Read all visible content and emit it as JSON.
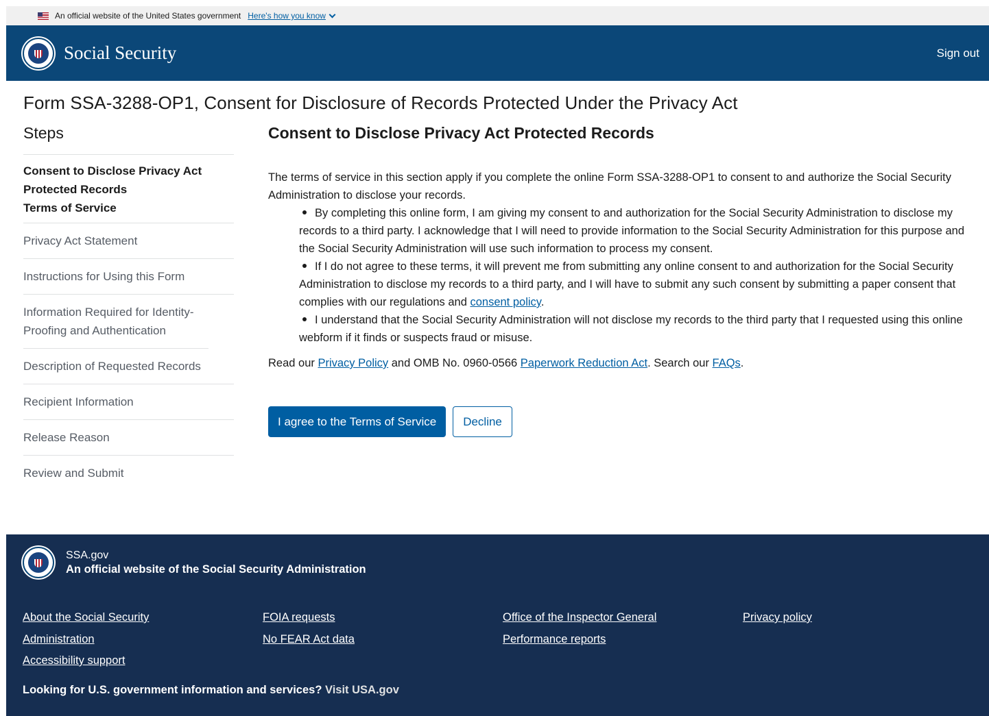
{
  "banner": {
    "official_text": "An official website of the United States government",
    "how_link": "Here's how you know"
  },
  "header": {
    "brand": "Social Security",
    "signout": "Sign out"
  },
  "form_title": "Form SSA-3288-OP1, Consent for Disclosure of Records Protected Under the Privacy Act",
  "steps": {
    "title": "Steps",
    "current_line1": "Consent to Disclose Privacy Act Protected Records",
    "current_line2": "Terms of Service",
    "items": [
      "Privacy Act Statement",
      "Instructions for Using this Form",
      "Information Required for Identity-Proofing and Authentication",
      "Description of Requested Records",
      "Recipient Information",
      "Release Reason",
      "Review and Submit"
    ]
  },
  "main": {
    "heading": "Consent to Disclose Privacy Act Protected Records",
    "intro": "The terms of service in this section apply if you complete the online Form SSA-3288-OP1 to consent to and authorize the Social Security Administration to disclose your records.",
    "bullet1": "By completing this online form, I am giving my consent to and authorization for the Social Security Administration to disclose my records to a third party.  I acknowledge that I will need to provide information to the Social Security Administration for this purpose and the Social Security Administration will use such information to process my consent.",
    "bullet2_pre": "If I do not agree to these terms, it will prevent me from submitting any online consent to and authorization for the Social Security Administration to disclose my records to a third party, and I will have to submit any such consent by submitting a paper consent that complies with our regulations and ",
    "bullet2_link": "consent policy",
    "bullet2_post": ".",
    "bullet3": "I understand that the Social Security Administration will not disclose my records to the third party that I requested using this online webform if it finds or suspects fraud or misuse.",
    "read_our": "Read our ",
    "privacy_policy": "Privacy Policy",
    "omb_text": " and OMB No. 0960-0566 ",
    "pra_link": "Paperwork Reduction Act",
    "search_text": ". Search our ",
    "faqs_link": "FAQs",
    "end_period": ".",
    "agree_button": "I agree to the Terms of Service",
    "decline_button": "Decline"
  },
  "footer": {
    "site": "SSA.gov",
    "official": "An official website of the Social Security Administration",
    "col1": [
      "About the Social Security Administration",
      "Accessibility support"
    ],
    "col2": [
      "FOIA requests",
      "No FEAR Act data"
    ],
    "col3": [
      "Office of the Inspector General",
      "Performance reports"
    ],
    "col4": [
      "Privacy policy"
    ],
    "usagov_text": "Looking for U.S. government information and services? ",
    "usagov_link": "Visit USA.gov"
  },
  "colors": {
    "header_bg": "#0b4778",
    "footer_bg": "#162e51",
    "link": "#005ea2",
    "primary_button": "#005ea2"
  }
}
